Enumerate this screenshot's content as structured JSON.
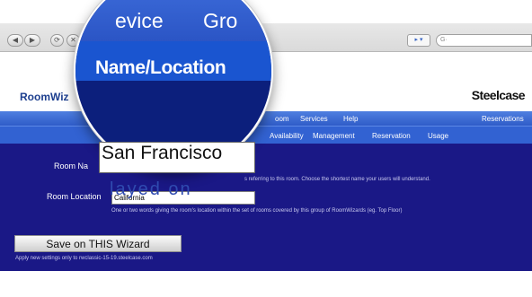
{
  "browser": {
    "nav_back": "◀",
    "nav_forward": "▶",
    "nav_reload": "⟳",
    "nav_stop": "✕",
    "go_label": "▸ ▾",
    "search_prefix": "G·"
  },
  "header": {
    "brand_left": "RoomWiz",
    "brand_right": "Steelcase"
  },
  "menu_top": {
    "items": [
      "oom",
      "Services",
      "Help"
    ],
    "right": "Reservations"
  },
  "menu_sub": {
    "items": [
      "Availability",
      "Management",
      "Reservation",
      "Usage"
    ]
  },
  "lens": {
    "tab_1": "evice",
    "tab_2": "Gro",
    "title": "Name/Location",
    "field_value": "San Francisco",
    "ghost_text": "layed on"
  },
  "form": {
    "room_name_label": "Room Na",
    "room_name_hint": "s referring to this room. Choose the shortest  name your users will understand.",
    "room_location_label": "Room Location",
    "room_location_value": "California",
    "room_location_hint": "One or two words giving the room's location within the set of rooms covered by this group of RoomWizards (eg. Top Floor)",
    "save_button": "Save on THIS Wizard",
    "save_hint": "Apply new settings only to rwclassic-15-19.steelcase.com"
  },
  "colors": {
    "content_bg": "#1a1886",
    "menu_blue": "#3262d2",
    "brand_blue": "#1d3f8f"
  }
}
